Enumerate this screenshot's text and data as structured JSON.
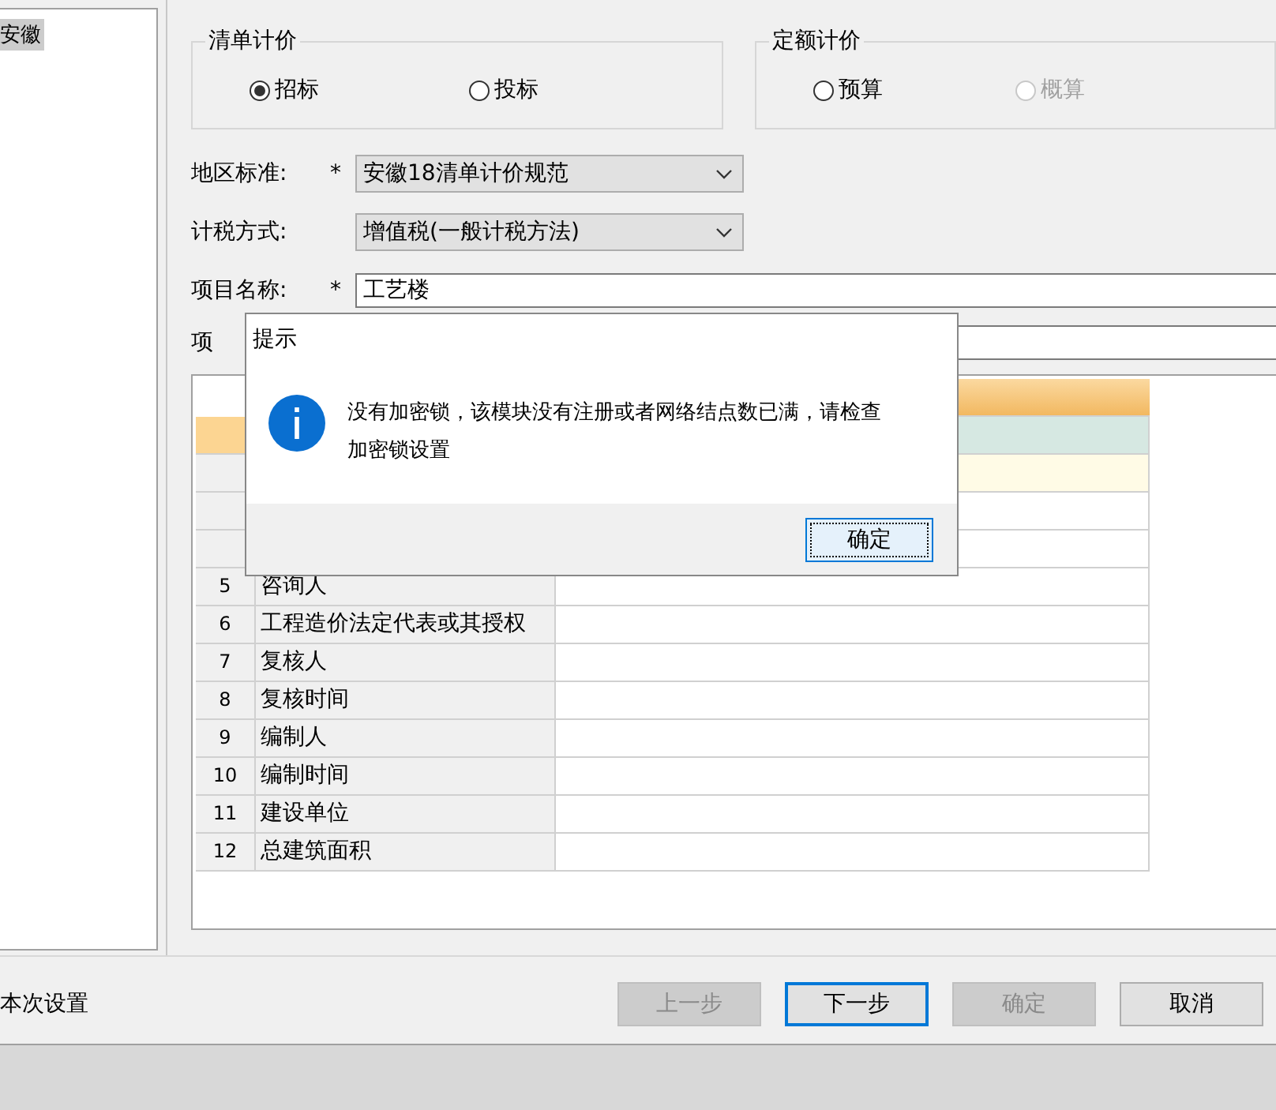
{
  "tree": {
    "items": [
      {
        "label": "安徽",
        "selected": true
      }
    ]
  },
  "pricing_groups": [
    {
      "title": "清单计价",
      "options": [
        {
          "label": "招标",
          "selected": true,
          "disabled": false
        },
        {
          "label": "投标",
          "selected": false,
          "disabled": false
        }
      ]
    },
    {
      "title": "定额计价",
      "options": [
        {
          "label": "预算",
          "selected": false,
          "disabled": false
        },
        {
          "label": "概算",
          "selected": false,
          "disabled": true
        }
      ]
    }
  ],
  "fields": [
    {
      "label": "地区标准:",
      "marker": "*",
      "kind": "dropdown",
      "value": "安徽18清单计价规范"
    },
    {
      "label": "计税方式:",
      "kind": "dropdown",
      "value": "增值税(一般计税方法)"
    },
    {
      "label": "项目名称:",
      "marker": "*",
      "kind": "text",
      "value": "工艺楼"
    },
    {
      "label": "项",
      "kind": "text"
    }
  ],
  "table": {
    "rows": [
      {
        "selected": true,
        "highlighted": false
      },
      {
        "selected": false,
        "highlighted": true
      },
      {
        "selected": false,
        "highlighted": false
      },
      {
        "selected": false,
        "highlighted": false
      },
      {
        "number": "5",
        "name": "咨询人",
        "selected": false,
        "highlighted": false
      },
      {
        "number": "6",
        "name": "工程造价法定代表或其授权",
        "selected": false,
        "highlighted": false
      },
      {
        "number": "7",
        "name": "复核人",
        "selected": false,
        "highlighted": false
      },
      {
        "number": "8",
        "name": "复核时间",
        "selected": false,
        "highlighted": false
      },
      {
        "number": "9",
        "name": "编制人",
        "selected": false,
        "highlighted": false
      },
      {
        "number": "10",
        "name": "编制时间",
        "selected": false,
        "highlighted": false
      },
      {
        "number": "11",
        "name": "建设单位",
        "selected": false,
        "highlighted": false
      },
      {
        "number": "12",
        "name": "总建筑面积",
        "selected": false,
        "highlighted": false
      }
    ]
  },
  "footer": {
    "note": "本次设置",
    "buttons": [
      {
        "label": "上一步",
        "disabled": true,
        "focused": false
      },
      {
        "label": "下一步",
        "disabled": false,
        "focused": true
      },
      {
        "label": "确定",
        "disabled": true,
        "focused": false
      },
      {
        "label": "取消",
        "disabled": false,
        "focused": false
      }
    ]
  },
  "dialog": {
    "title": "提示",
    "message": "没有加密锁，该模块没有注册或者网络结点数已满，请检查加密锁设置",
    "button": "确定"
  }
}
